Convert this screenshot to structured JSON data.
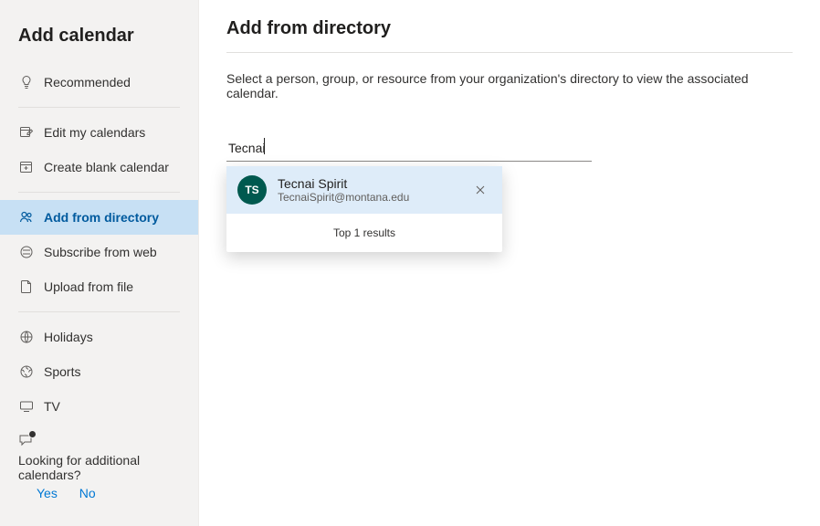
{
  "sidebar": {
    "title": "Add calendar",
    "items": [
      {
        "label": "Recommended"
      },
      {
        "label": "Edit my calendars"
      },
      {
        "label": "Create blank calendar"
      },
      {
        "label": "Add from directory"
      },
      {
        "label": "Subscribe from web"
      },
      {
        "label": "Upload from file"
      },
      {
        "label": "Holidays"
      },
      {
        "label": "Sports"
      },
      {
        "label": "TV"
      }
    ],
    "feedback": {
      "question": "Looking for additional calendars?",
      "yes": "Yes",
      "no": "No"
    }
  },
  "main": {
    "title": "Add from directory",
    "description": "Select a person, group, or resource from your organization's directory to view the associated calendar.",
    "search_value": "Tecnai",
    "results_footer": "Top 1 results",
    "result": {
      "initials": "TS",
      "name": "Tecnai Spirit",
      "email": "TecnaiSpirit@montana.edu"
    }
  }
}
